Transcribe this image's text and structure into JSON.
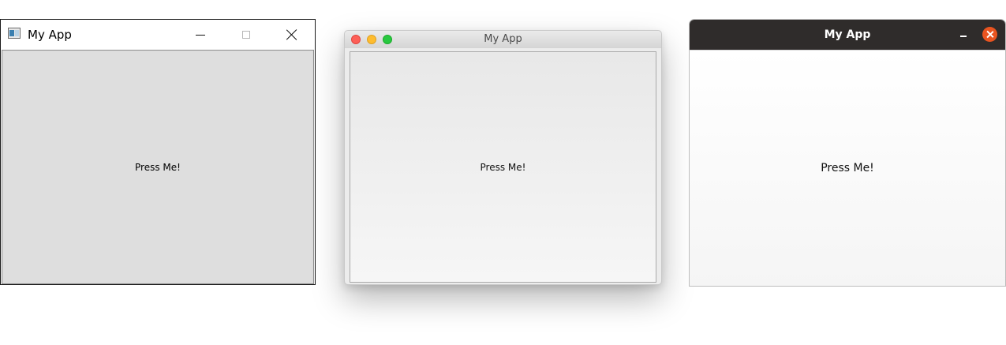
{
  "windows": {
    "windows_style": {
      "title": "My App",
      "button_label": "Press Me!"
    },
    "mac_style": {
      "title": "My App",
      "button_label": "Press Me!",
      "traffic_light_colors": {
        "close": "#fd5f57",
        "minimize": "#febc2e",
        "zoom": "#28c840"
      }
    },
    "ubuntu_style": {
      "title": "My App",
      "button_label": "Press Me!",
      "accent_color": "#e95420",
      "titlebar_color": "#2f2c2b"
    }
  }
}
